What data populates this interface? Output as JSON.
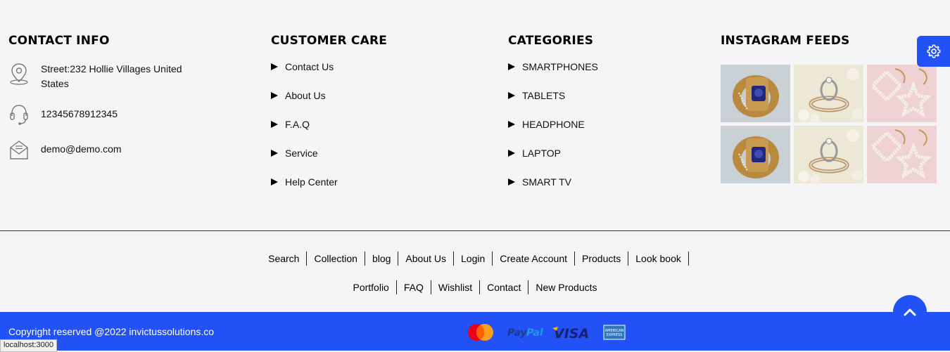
{
  "contact": {
    "heading": "CONTACT INFO",
    "address": "Street:232 Hollie Villages United States",
    "phone": "12345678912345",
    "email": "demo@demo.com",
    "icons": [
      "location-pin-icon",
      "headset-icon",
      "mail-icon"
    ]
  },
  "care": {
    "heading": "CUSTOMER CARE",
    "items": [
      "Contact Us",
      "About Us",
      "F.A.Q",
      "Service",
      "Help Center"
    ]
  },
  "categories": {
    "heading": "CATEGORIES",
    "items": [
      "SMARTPHONES",
      "TABLETS",
      "HEADPHONE",
      "LAPTOP",
      "SMART TV"
    ]
  },
  "instagram": {
    "heading": "INSTAGRAM FEEDS",
    "photos": [
      "sapphire-ring",
      "diamond-ring-pearls",
      "pearl-star-earrings",
      "sapphire-ring",
      "diamond-ring-pearls",
      "pearl-star-earrings"
    ]
  },
  "footer_links": {
    "row1": [
      "Search",
      "Collection",
      "blog",
      "About Us",
      "Login",
      "Create Account",
      "Products",
      "Look book"
    ],
    "row2": [
      "Portfolio",
      "FAQ",
      "Wishlist",
      "Contact",
      "New Products"
    ]
  },
  "bottom": {
    "copyright": "Copyright reserved @2022 invictussolutions.co",
    "payments": [
      "mastercard",
      "PayPal",
      "VISA",
      "AMERICAN EXPRESS"
    ]
  },
  "status_url": "localhost:3000",
  "colors": {
    "accent": "#2251f5",
    "background": "#f5f5f8"
  }
}
